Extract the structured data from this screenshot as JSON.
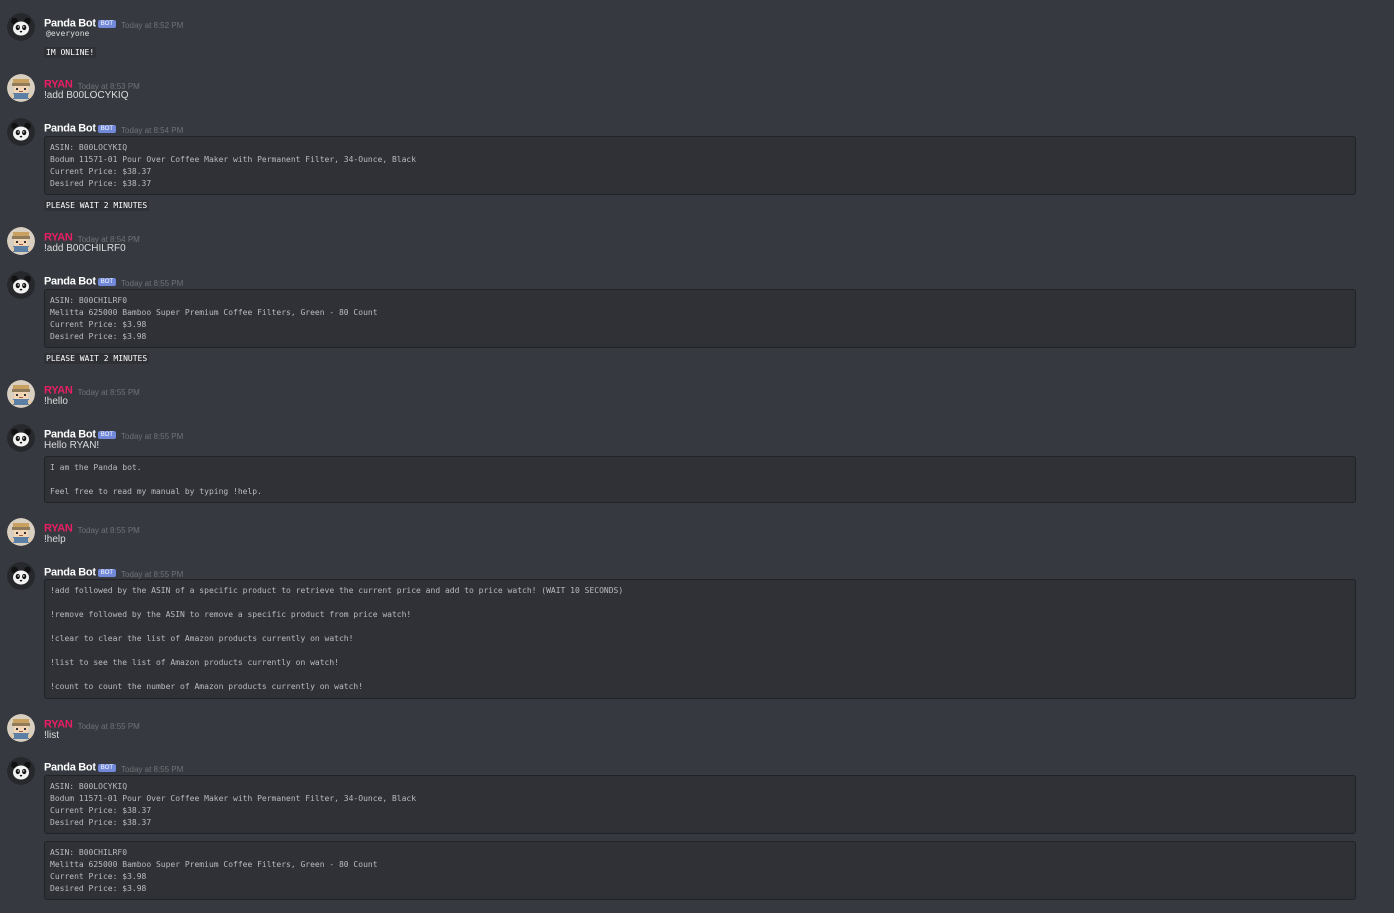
{
  "colors": {
    "background": "#36393f",
    "codeblock_bg": "#2f3136",
    "bot_name": "#ffffff",
    "user_name": "#e91e63",
    "bot_tag": "#7289da",
    "timestamp": "#6f7277",
    "text": "#dcddde"
  },
  "bot": {
    "name": "Panda Bot",
    "tag": "BOT",
    "avatar_icon": "panda-icon"
  },
  "user": {
    "name": "RYAN",
    "avatar_icon": "pixel-character-icon"
  },
  "messages": [
    {
      "author": "bot",
      "time": "Today at 8:52 PM",
      "mention": "@everyone",
      "inline_code": "IM ONLINE!"
    },
    {
      "author": "user",
      "time": "Today at 8:53 PM",
      "text": "!add B00LOCYKIQ"
    },
    {
      "author": "bot",
      "time": "Today at 8:54 PM",
      "code": [
        "ASIN: B00LOCYKIQ",
        "Bodum 11571-01 Pour Over Coffee Maker with Permanent Filter, 34-Ounce, Black",
        "Current Price: $38.37",
        "Desired Price: $38.37"
      ],
      "inline_code": "PLEASE WAIT 2 MINUTES"
    },
    {
      "author": "user",
      "time": "Today at 8:54 PM",
      "text": "!add B00CHILRF0"
    },
    {
      "author": "bot",
      "time": "Today at 8:55 PM",
      "code": [
        "ASIN: B00CHILRF0",
        "Melitta 625000 Bamboo Super Premium Coffee Filters, Green - 80 Count",
        "Current Price: $3.98",
        "Desired Price: $3.98"
      ],
      "inline_code": "PLEASE WAIT 2 MINUTES"
    },
    {
      "author": "user",
      "time": "Today at 8:55 PM",
      "text": "!hello"
    },
    {
      "author": "bot",
      "time": "Today at 8:55 PM",
      "text": "Hello RYAN!",
      "code": [
        "I am the Panda bot.",
        "",
        "Feel free to read my manual by typing !help."
      ]
    },
    {
      "author": "user",
      "time": "Today at 8:55 PM",
      "text": "!help"
    },
    {
      "author": "bot",
      "time": "Today at 8:55 PM",
      "code": [
        "!add followed by the ASIN of a specific product to retrieve the current price and add to price watch! (WAIT 10 SECONDS)",
        "",
        "!remove followed by the ASIN to remove a specific product from price watch!",
        "",
        "!clear to clear the list of Amazon products currently on watch!",
        "",
        "!list to see the list of Amazon products currently on watch!",
        "",
        "!count to count the number of Amazon products currently on watch!"
      ]
    },
    {
      "author": "user",
      "time": "Today at 8:55 PM",
      "text": "!list"
    },
    {
      "author": "bot",
      "time": "Today at 8:55 PM",
      "code": [
        "ASIN: B00LOCYKIQ",
        "Bodum 11571-01 Pour Over Coffee Maker with Permanent Filter, 34-Ounce, Black",
        "Current Price: $38.37",
        "Desired Price: $38.37"
      ],
      "code2": [
        "ASIN: B00CHILRF0",
        "Melitta 625000 Bamboo Super Premium Coffee Filters, Green - 80 Count",
        "Current Price: $3.98",
        "Desired Price: $3.98"
      ]
    }
  ]
}
